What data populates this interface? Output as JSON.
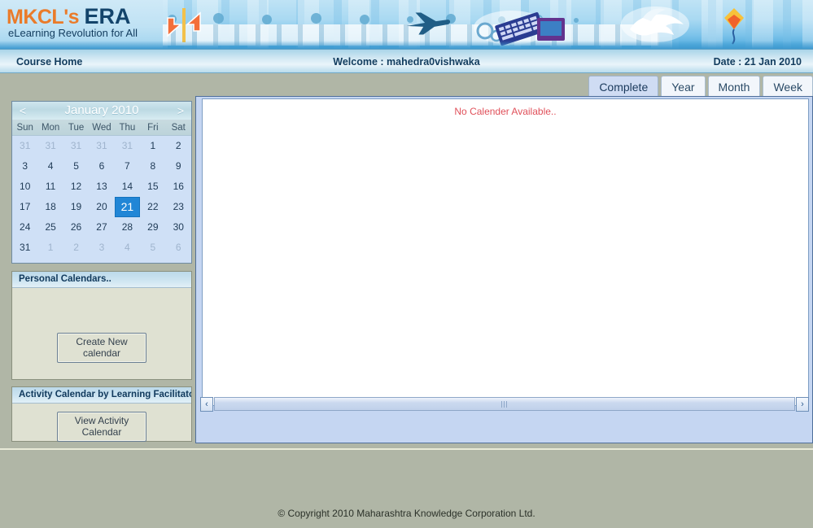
{
  "banner": {
    "logo_main_prefix": "MKCL's",
    "logo_main_suffix": "ERA",
    "tagline": "eLearning Revolution for All",
    "icons": [
      "arrow-sign-icon",
      "airplane-icon",
      "computer-keyboard-icon",
      "dove-icon",
      "kite-icon"
    ]
  },
  "navbar": {
    "course_home": "Course Home",
    "welcome": "Welcome : mahedra0vishwaka",
    "date": "Date : 21 Jan 2010"
  },
  "tabs": [
    {
      "label": "Complete",
      "active": true
    },
    {
      "label": "Year",
      "active": false
    },
    {
      "label": "Month",
      "active": false
    },
    {
      "label": "Week",
      "active": false
    }
  ],
  "calendar": {
    "prev_label": "<",
    "next_label": ">",
    "title": "January 2010",
    "day_headers": [
      "Sun",
      "Mon",
      "Tue",
      "Wed",
      "Thu",
      "Fri",
      "Sat"
    ],
    "today": 21,
    "weeks": [
      [
        {
          "d": "31",
          "other": true
        },
        {
          "d": "31",
          "other": true
        },
        {
          "d": "31",
          "other": true
        },
        {
          "d": "31",
          "other": true
        },
        {
          "d": "31",
          "other": true
        },
        {
          "d": "1",
          "other": false
        },
        {
          "d": "2",
          "other": false
        }
      ],
      [
        {
          "d": "3",
          "other": false
        },
        {
          "d": "4",
          "other": false
        },
        {
          "d": "5",
          "other": false
        },
        {
          "d": "6",
          "other": false
        },
        {
          "d": "7",
          "other": false
        },
        {
          "d": "8",
          "other": false
        },
        {
          "d": "9",
          "other": false
        }
      ],
      [
        {
          "d": "10",
          "other": false
        },
        {
          "d": "11",
          "other": false
        },
        {
          "d": "12",
          "other": false
        },
        {
          "d": "13",
          "other": false
        },
        {
          "d": "14",
          "other": false
        },
        {
          "d": "15",
          "other": false
        },
        {
          "d": "16",
          "other": false
        }
      ],
      [
        {
          "d": "17",
          "other": false
        },
        {
          "d": "18",
          "other": false
        },
        {
          "d": "19",
          "other": false
        },
        {
          "d": "20",
          "other": false
        },
        {
          "d": "21",
          "other": false,
          "today": true
        },
        {
          "d": "22",
          "other": false
        },
        {
          "d": "23",
          "other": false
        }
      ],
      [
        {
          "d": "24",
          "other": false
        },
        {
          "d": "25",
          "other": false
        },
        {
          "d": "26",
          "other": false
        },
        {
          "d": "27",
          "other": false
        },
        {
          "d": "28",
          "other": false
        },
        {
          "d": "29",
          "other": false
        },
        {
          "d": "30",
          "other": false
        }
      ],
      [
        {
          "d": "31",
          "other": false
        },
        {
          "d": "1",
          "other": true
        },
        {
          "d": "2",
          "other": true
        },
        {
          "d": "3",
          "other": true
        },
        {
          "d": "4",
          "other": true
        },
        {
          "d": "5",
          "other": true
        },
        {
          "d": "6",
          "other": true
        }
      ]
    ]
  },
  "personal_panel": {
    "title": "Personal Calendars..",
    "button": "Create New calendar"
  },
  "activity_panel": {
    "title": "Activity Calendar by Learning Facilitator",
    "button": "View Activity Calendar"
  },
  "content": {
    "message": "No Calender Available..",
    "scroll_left": "‹",
    "scroll_right": "›"
  },
  "footer": {
    "copyright": "© Copyright 2010 Maharashtra Knowledge Corporation Ltd."
  },
  "colors": {
    "page_bg": "#b0b6a6",
    "accent_blue": "#2186d6",
    "alert_red": "#e0505a",
    "brand_orange": "#ea7b2a",
    "brand_navy": "#13446b"
  }
}
